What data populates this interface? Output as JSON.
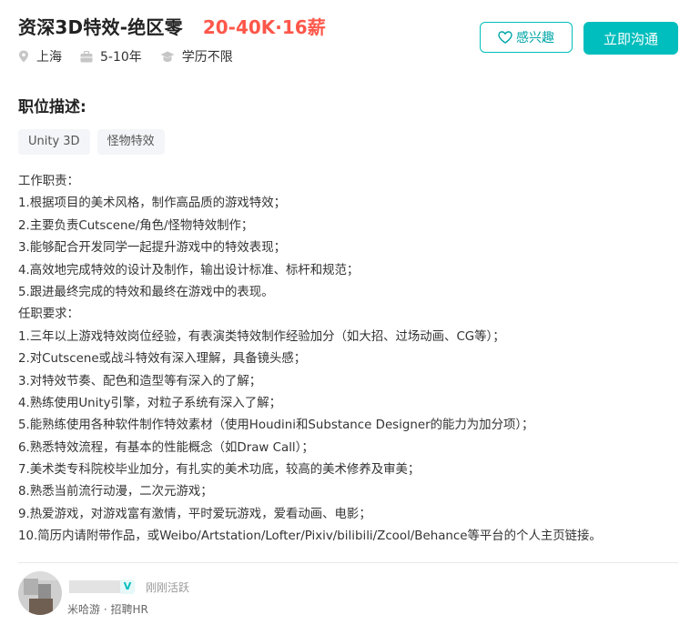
{
  "job": {
    "title": "资深3D特效-绝区零",
    "salary": "20-40K·16薪",
    "location": "上海",
    "experience": "5-10年",
    "education": "学历不限"
  },
  "actions": {
    "interest_label": "感兴趣",
    "chat_label": "立即沟通"
  },
  "description": {
    "section_title": "职位描述:",
    "tags": [
      "Unity 3D",
      "怪物特效"
    ],
    "lines": [
      "工作职责：",
      "1.根据项目的美术风格，制作高品质的游戏特效；",
      "2.主要负责Cutscene/角色/怪物特效制作；",
      "3.能够配合开发同学一起提升游戏中的特效表现；",
      "4.高效地完成特效的设计及制作，输出设计标准、标杆和规范；",
      "5.跟进最终完成的特效和最终在游戏中的表现。",
      "任职要求：",
      "1.三年以上游戏特效岗位经验，有表演类特效制作经验加分（如大招、过场动画、CG等）；",
      "2.对Cutscene或战斗特效有深入理解，具备镜头感；",
      "3.对特效节奏、配色和造型等有深入的了解；",
      "4.熟练使用Unity引擎，对粒子系统有深入了解；",
      "5.能熟练使用各种软件制作特效素材（使用Houdini和Substance Designer的能力为加分项）；",
      "6.熟悉特效流程，有基本的性能概念（如Draw Call）；",
      "7.美术类专科院校毕业加分，有扎实的美术功底，较高的美术修养及审美；",
      "8.熟悉当前流行动漫，二次元游戏；",
      "9.热爱游戏，对游戏富有激情，平时爱玩游戏，爱看动画、电影；",
      "10.简历内请附带作品，或Weibo/Artstation/Lofter/Pixiv/bilibili/Zcool/Behance等平台的个人主页链接。"
    ]
  },
  "hr": {
    "badge": "V",
    "active_status": "刚刚活跃",
    "company_role": "米哈游 · 招聘HR"
  },
  "colors": {
    "accent": "#00bebd",
    "salary": "#fe574a"
  },
  "icons": {
    "location": "location-pin-icon",
    "experience": "briefcase-icon",
    "education": "graduation-cap-icon",
    "interest": "heart-icon"
  }
}
